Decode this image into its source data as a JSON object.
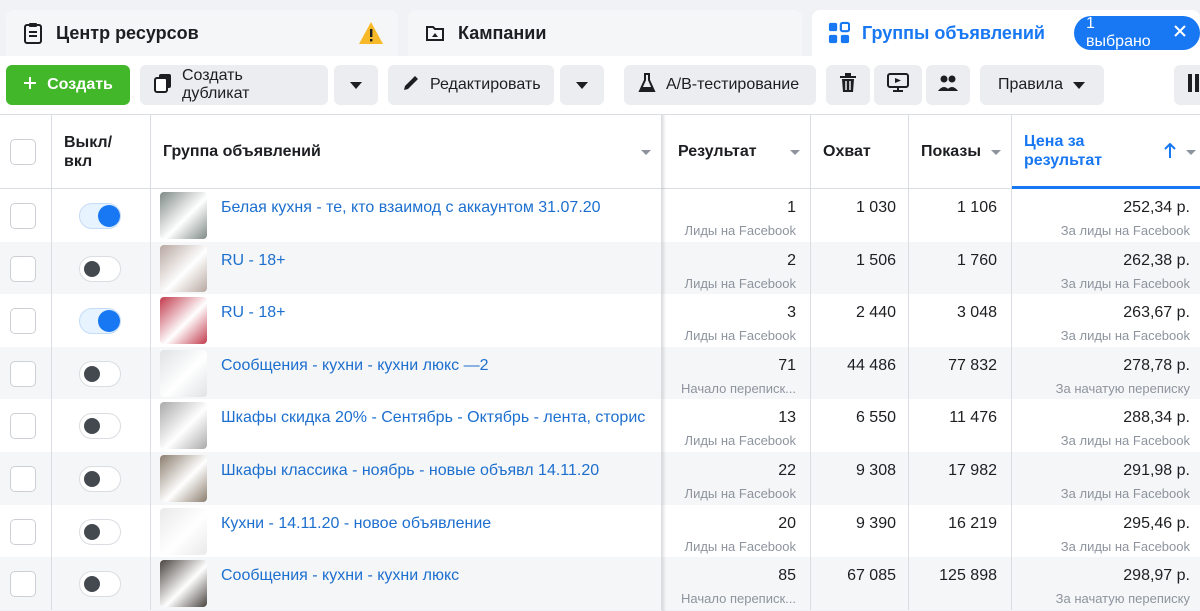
{
  "tabs": [
    {
      "label": "Центр ресурсов",
      "icon": "clipboard-icon"
    },
    {
      "label": "Кампании",
      "icon": "folder-icon"
    },
    {
      "label": "Группы объявлений",
      "icon": "grid-icon"
    }
  ],
  "selection_badge": "1 выбрано",
  "toolbar": {
    "create": "Создать",
    "duplicate": "Создать дубликат",
    "edit": "Редактировать",
    "ab_test": "A/B-тестирование",
    "rules": "Правила"
  },
  "columns": {
    "toggle": "Выкл/\nвкл",
    "name": "Группа объявлений",
    "result": "Результат",
    "reach": "Охват",
    "impressions": "Показы",
    "cost": "Цена за результат"
  },
  "rows": [
    {
      "name": "Белая кухня - те, кто взаимод с аккаунтом 31.07.20",
      "on": true,
      "result": "1",
      "result_type": "Лиды на Facebook",
      "reach": "1 030",
      "impressions": "1 106",
      "cost": "252,34 р.",
      "cost_type": "За лиды на Facebook"
    },
    {
      "name": "RU - 18+",
      "on": false,
      "result": "2",
      "result_type": "Лиды на Facebook",
      "reach": "1 506",
      "impressions": "1 760",
      "cost": "262,38 р.",
      "cost_type": "За лиды на Facebook"
    },
    {
      "name": "RU - 18+",
      "on": true,
      "result": "3",
      "result_type": "Лиды на Facebook",
      "reach": "2 440",
      "impressions": "3 048",
      "cost": "263,67 р.",
      "cost_type": "За лиды на Facebook"
    },
    {
      "name": "Сообщения - кухни - кухни люкс —2",
      "on": false,
      "result": "71",
      "result_type": "Начало переписк...",
      "reach": "44 486",
      "impressions": "77 832",
      "cost": "278,78 р.",
      "cost_type": "За начатую переписку"
    },
    {
      "name": "Шкафы скидка 20% - Сентябрь - Октябрь - лента, сторис",
      "on": false,
      "result": "13",
      "result_type": "Лиды на Facebook",
      "reach": "6 550",
      "impressions": "11 476",
      "cost": "288,34 р.",
      "cost_type": "За лиды на Facebook"
    },
    {
      "name": "Шкафы классика - ноябрь - новые объявл 14.11.20",
      "on": false,
      "result": "22",
      "result_type": "Лиды на Facebook",
      "reach": "9 308",
      "impressions": "17 982",
      "cost": "291,98 р.",
      "cost_type": "За лиды на Facebook"
    },
    {
      "name": "Кухни - 14.11.20 - новое объявление",
      "on": false,
      "result": "20",
      "result_type": "Лиды на Facebook",
      "reach": "9 390",
      "impressions": "16 219",
      "cost": "295,46 р.",
      "cost_type": "За лиды на Facebook"
    },
    {
      "name": "Сообщения - кухни - кухни люкс",
      "on": false,
      "result": "85",
      "result_type": "Начало переписк...",
      "reach": "67 085",
      "impressions": "125 898",
      "cost": "298,97 р.",
      "cost_type": "За начатую переписку"
    }
  ],
  "thumb_colors": [
    "#7f8a86",
    "#b7a7a0",
    "#c23a4c",
    "#dfe2e4",
    "#a9a9a9",
    "#8b7d6e",
    "#e9e9e9",
    "#4a4440"
  ],
  "colors": {
    "accent": "#1877f2",
    "create_green": "#42b72a",
    "link": "#1d6fcf",
    "warning": "#f7b928"
  }
}
